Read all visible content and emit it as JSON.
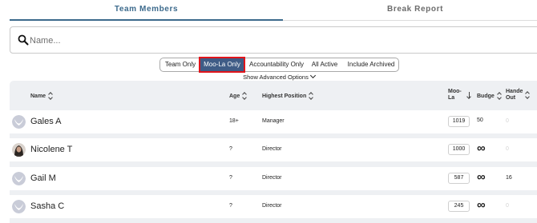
{
  "tabs": [
    {
      "label": "Team Members",
      "active": true
    },
    {
      "label": "Break Report",
      "active": false
    }
  ],
  "search": {
    "placeholder": "Name..."
  },
  "filters": [
    {
      "label": "Team Only",
      "selected": false
    },
    {
      "label": "Moo-La Only",
      "selected": true
    },
    {
      "label": "Accountability Only",
      "selected": false
    },
    {
      "label": "All Active",
      "selected": false
    },
    {
      "label": "Include Archived",
      "selected": false
    }
  ],
  "advanced_options": "Show Advanced Options",
  "table": {
    "headers": {
      "name": "Name",
      "age": "Age",
      "position": "Highest Position",
      "moola_line1": "Moo-",
      "moola_line2": "La",
      "budget": "Budge",
      "handed_line1": "Hande",
      "handed_line2": "Out"
    },
    "rows": [
      {
        "name": "Gales A",
        "age": "18+",
        "position": "Manager",
        "moola": "1019",
        "budget": "50",
        "handed_out": "0"
      },
      {
        "name": "Nicolene T",
        "age": "?",
        "position": "Director",
        "moola": "1000",
        "budget": "∞",
        "handed_out": "0"
      },
      {
        "name": "Gail M",
        "age": "?",
        "position": "Director",
        "moola": "587",
        "budget": "∞",
        "handed_out": "16"
      },
      {
        "name": "Sasha C",
        "age": "?",
        "position": "Director",
        "moola": "245",
        "budget": "∞",
        "handed_out": "0"
      }
    ]
  },
  "colors": {
    "accent": "#3c6a8c",
    "selected_filter_bg": "#3f5c86",
    "highlight_border": "#e0141b",
    "table_bg": "#eef0f3"
  }
}
